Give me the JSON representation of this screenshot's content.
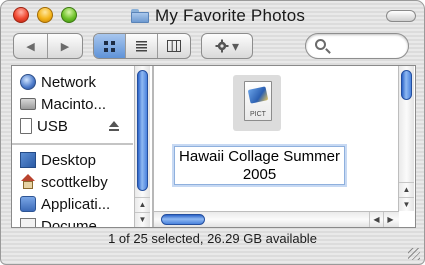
{
  "window": {
    "title": "My Favorite Photos"
  },
  "toolbar": {
    "back": "◀",
    "forward": "▶",
    "views": {
      "icon": "icon-view-icon",
      "list": "list-view-icon",
      "column": "column-view-icon"
    },
    "action": {
      "icon": "gear-icon",
      "caret": "▾"
    },
    "search": {
      "placeholder": "",
      "value": ""
    }
  },
  "sidebar": {
    "devices": [
      {
        "label": "Network",
        "icon": "network-globe-icon"
      },
      {
        "label": "Macinto...",
        "icon": "hard-disk-icon"
      },
      {
        "label": "USB",
        "icon": "usb-drive-icon",
        "eject": true
      }
    ],
    "places": [
      {
        "label": "Desktop",
        "icon": "desktop-icon"
      },
      {
        "label": "scottkelby",
        "icon": "home-icon"
      },
      {
        "label": "Applicati...",
        "icon": "applications-icon"
      },
      {
        "label": "Docume...",
        "icon": "documents-icon"
      }
    ]
  },
  "file": {
    "type_label": "PICT",
    "name_line1": "Hawaii Collage Summer",
    "name_line2": "2005"
  },
  "status": {
    "text": "1 of 25 selected, 26.29 GB available"
  },
  "colors": {
    "accent": "#5f93d8",
    "selection_border": "#8fb0dd"
  }
}
